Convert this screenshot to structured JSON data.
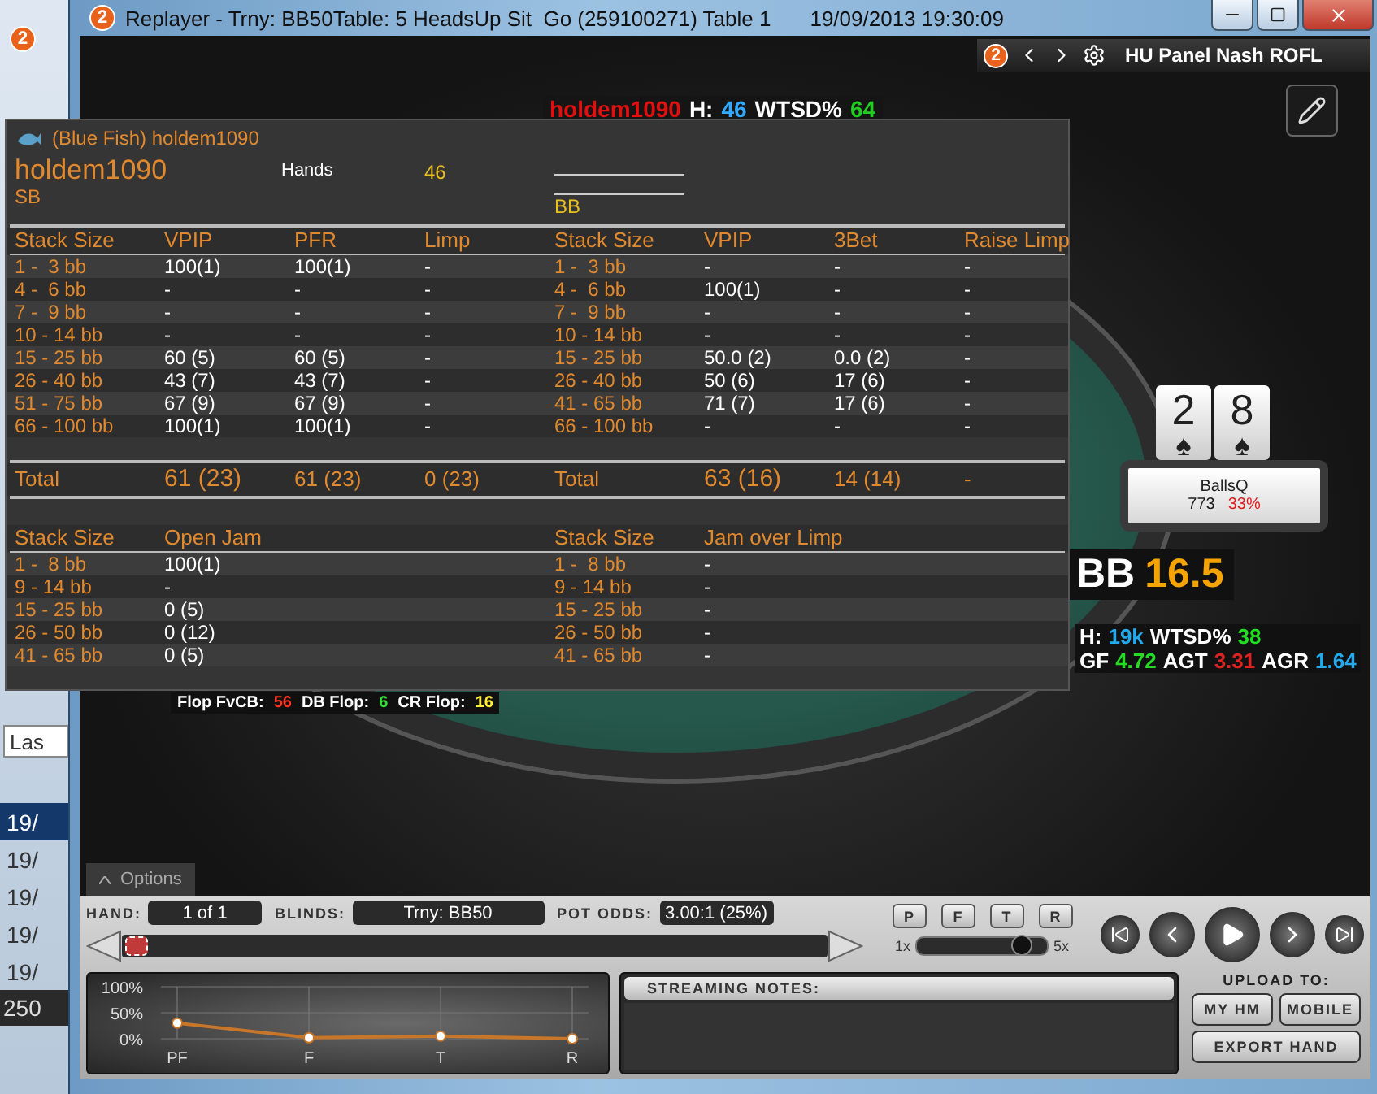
{
  "background_window": {
    "badge": "2",
    "filter": "Las",
    "rows": [
      {
        "text": "19/",
        "selected": true
      },
      {
        "text": "19/",
        "selected": false
      },
      {
        "text": "19/",
        "selected": false
      },
      {
        "text": "19/",
        "selected": false
      },
      {
        "text": "19/",
        "selected": false
      }
    ],
    "footer": "250"
  },
  "window": {
    "badge": "2",
    "title": "Replayer - Trny: BB50Table: 5 HeadsUp Sit  Go (259100271) Table 1",
    "timestamp": "19/09/2013 19:30:09"
  },
  "hud_toolbar": {
    "badge": "2",
    "title": "HU Panel Nash ROFL"
  },
  "villain_hud": {
    "name": "holdem1090",
    "stats": [
      {
        "label": "H:",
        "value": "46",
        "color": "#33aaff"
      },
      {
        "label": "WTSD%",
        "value": "64",
        "color": "#22cc22"
      }
    ]
  },
  "hero": {
    "cards": [
      {
        "rank": "2",
        "suit": "♠"
      },
      {
        "rank": "8",
        "suit": "♠"
      }
    ],
    "name": "BallsQ",
    "chips": "773",
    "equity": "33%",
    "stack_label": "BB",
    "stack_value": "16.5",
    "stats": [
      [
        {
          "label": "H:",
          "value": "19k",
          "color": "#22aaee"
        },
        {
          "label": "WTSD%",
          "value": "38",
          "color": "#22dd22"
        }
      ],
      [
        {
          "label": "GF",
          "value": "4.72",
          "color": "#22dd22"
        },
        {
          "label": "AGT",
          "value": "3.31",
          "color": "#dd2222"
        },
        {
          "label": "AGR",
          "value": "1.64",
          "color": "#22aaee"
        }
      ]
    ]
  },
  "flop_stats": [
    {
      "label": "Flop FvCB:",
      "value": "56",
      "color": "#ff3322"
    },
    {
      "label": "DB Flop:",
      "value": "6",
      "color": "#33dd33"
    },
    {
      "label": "CR Flop:",
      "value": "16",
      "color": "#ffee33"
    }
  ],
  "popup": {
    "title": "(Blue Fish) holdem1090",
    "player": "holdem1090",
    "position": "SB",
    "hands_label": "Hands",
    "hands_value": "46",
    "opponent_position": "BB",
    "sb_table": {
      "columns": [
        "Stack Size",
        "VPIP",
        "PFR",
        "Limp"
      ],
      "rows": [
        [
          "1 -  3 bb",
          "100(1)",
          "100(1)",
          "-"
        ],
        [
          "4 -  6 bb",
          "-",
          "-",
          "-"
        ],
        [
          "7 -  9 bb",
          "-",
          "-",
          "-"
        ],
        [
          "10 - 14 bb",
          "-",
          "-",
          "-"
        ],
        [
          "15 - 25 bb",
          "60 (5)",
          "60 (5)",
          "-"
        ],
        [
          "26 - 40 bb",
          "43 (7)",
          "43 (7)",
          "-"
        ],
        [
          "51 - 75 bb",
          "67 (9)",
          "67 (9)",
          "-"
        ],
        [
          "66 - 100 bb",
          "100(1)",
          "100(1)",
          "-"
        ]
      ],
      "total": [
        "Total",
        "61 (23)",
        "61 (23)",
        "0 (23)"
      ]
    },
    "bb_table": {
      "columns": [
        "Stack Size",
        "VPIP",
        "3Bet",
        "Raise Limp"
      ],
      "rows": [
        [
          "1 -  3 bb",
          "-",
          "-",
          "-"
        ],
        [
          "4 -  6 bb",
          "100(1)",
          "-",
          "-"
        ],
        [
          "7 -  9 bb",
          "-",
          "-",
          "-"
        ],
        [
          "10 - 14 bb",
          "-",
          "-",
          "-"
        ],
        [
          "15 - 25 bb",
          "50.0 (2)",
          "0.0 (2)",
          "-"
        ],
        [
          "26 - 40 bb",
          "50 (6)",
          "17 (6)",
          "-"
        ],
        [
          "41 - 65 bb",
          "71 (7)",
          "17 (6)",
          "-"
        ],
        [
          "66 - 100 bb",
          "-",
          "-",
          "-"
        ]
      ],
      "total": [
        "Total",
        "63 (16)",
        "14 (14)",
        "-"
      ]
    },
    "jam_left": {
      "columns": [
        "Stack Size",
        "Open Jam"
      ],
      "rows": [
        [
          "1 -  8 bb",
          "100(1)"
        ],
        [
          "9 - 14 bb",
          "-"
        ],
        [
          "15 - 25 bb",
          "0 (5)"
        ],
        [
          "26 - 50 bb",
          "0 (12)"
        ],
        [
          "41 - 65 bb",
          "0 (5)"
        ]
      ]
    },
    "jam_right": {
      "columns": [
        "Stack Size",
        "Jam over Limp"
      ],
      "rows": [
        [
          "1 -  8 bb",
          "-"
        ],
        [
          "9 - 14 bb",
          "-"
        ],
        [
          "15 - 25 bb",
          "-"
        ],
        [
          "26 - 50 bb",
          "-"
        ],
        [
          "41 - 65 bb",
          "-"
        ]
      ]
    }
  },
  "options_tab": "Options",
  "controls": {
    "fields": [
      {
        "label": "HAND:",
        "value": "1 of 1"
      },
      {
        "label": "BLINDS:",
        "value": "Trny: BB50"
      },
      {
        "label": "POT ODDS:",
        "value": "3.00:1 (25%)"
      }
    ],
    "progress": {
      "level": 0
    },
    "street_buttons": [
      "P",
      "F",
      "T",
      "R"
    ],
    "speed": {
      "min": "1x",
      "max": "5x",
      "level": 0.8
    }
  },
  "chart": {
    "chart_data": {
      "type": "line",
      "categories": [
        "PF",
        "F",
        "T",
        "R"
      ],
      "series": [
        {
          "color": "#c8762a",
          "marker": "circle",
          "values": [
            30,
            2,
            5,
            0
          ]
        }
      ],
      "grid": true,
      "ylim": [
        0,
        100
      ],
      "yticks": [
        {
          "value": 0,
          "label": "0%"
        },
        {
          "value": 50,
          "label": "50%"
        },
        {
          "value": 100,
          "label": "100%"
        }
      ]
    }
  },
  "streaming_notes": {
    "title": "STREAMING NOTES:"
  },
  "upload": {
    "title": "UPLOAD TO:",
    "buttons": [
      "MY HM",
      "MOBILE"
    ],
    "export": "EXPORT HAND"
  }
}
